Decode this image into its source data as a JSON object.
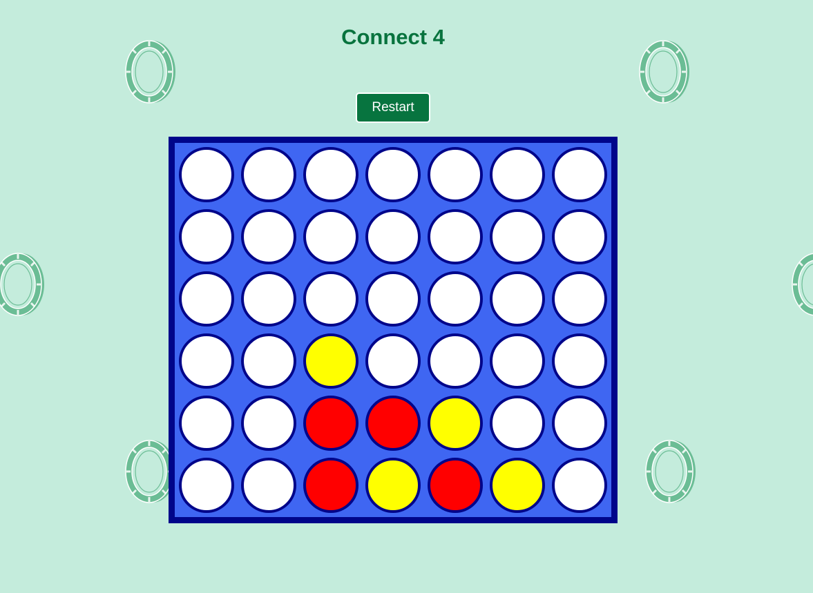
{
  "title": "Connect 4",
  "restart_label": "Restart",
  "colors": {
    "background": "#c4ecdc",
    "title": "#08733e",
    "button": "#07743f",
    "board": "#3f66f2",
    "board_border": "#00058a",
    "empty": "#ffffff",
    "red": "#ff0000",
    "yellow": "#ffff00",
    "chip": "#6bbd95"
  },
  "board": {
    "rows": 6,
    "columns": 7,
    "cells": [
      [
        "empty",
        "empty",
        "empty",
        "empty",
        "empty",
        "empty",
        "empty"
      ],
      [
        "empty",
        "empty",
        "empty",
        "empty",
        "empty",
        "empty",
        "empty"
      ],
      [
        "empty",
        "empty",
        "empty",
        "empty",
        "empty",
        "empty",
        "empty"
      ],
      [
        "empty",
        "empty",
        "yellow",
        "empty",
        "empty",
        "empty",
        "empty"
      ],
      [
        "empty",
        "empty",
        "red",
        "red",
        "yellow",
        "empty",
        "empty"
      ],
      [
        "empty",
        "empty",
        "red",
        "yellow",
        "red",
        "yellow",
        "empty"
      ]
    ]
  },
  "decorations": [
    "poker-chip-icon",
    "poker-chip-icon",
    "poker-chip-icon",
    "poker-chip-icon",
    "poker-chip-icon",
    "poker-chip-icon"
  ]
}
